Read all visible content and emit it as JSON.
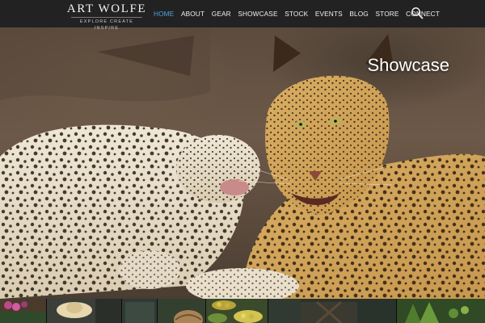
{
  "header": {
    "logo_name": "ART WOLFE",
    "logo_tagline": "EXPLORE  CREATE  INSPIRE",
    "nav": [
      {
        "label": "HOME",
        "active": true
      },
      {
        "label": "ABOUT",
        "active": false
      },
      {
        "label": "GEAR",
        "active": false
      },
      {
        "label": "SHOWCASE",
        "active": false
      },
      {
        "label": "STOCK",
        "active": false
      },
      {
        "label": "EVENTS",
        "active": false
      },
      {
        "label": "BLOG",
        "active": false
      },
      {
        "label": "STORE",
        "active": false
      },
      {
        "label": "CONNECT",
        "active": false
      }
    ],
    "search_icon": "search-icon",
    "active_color": "#4aa3df"
  },
  "hero": {
    "title": "Showcase",
    "image": "two leopards nuzzling"
  },
  "thumbnails": [
    "flowers",
    "straw hat",
    "wooden crate",
    "woven basket",
    "fruit baskets",
    "market stall",
    "green produce"
  ]
}
